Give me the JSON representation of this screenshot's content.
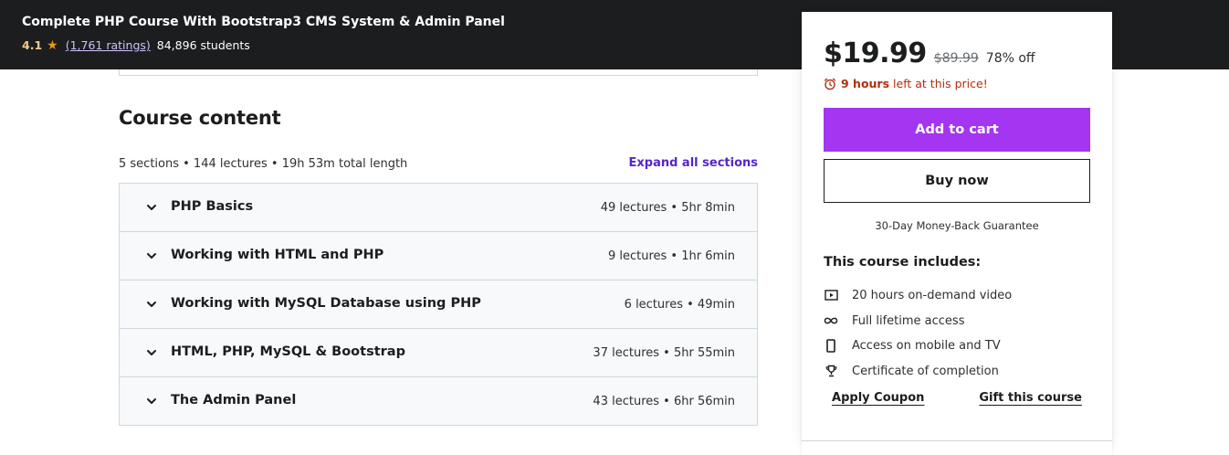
{
  "header": {
    "course_title": "Complete PHP Course With Bootstrap3 CMS System & Admin Panel",
    "rating": "4.1",
    "ratings_link": "(1,761 ratings)",
    "students": "84,896 students"
  },
  "course_content": {
    "title": "Course content",
    "summary": "5 sections • 144 lectures • 19h 53m total length",
    "expand_all": "Expand all sections",
    "sections": [
      {
        "title": "PHP Basics",
        "meta": "49 lectures • 5hr 8min"
      },
      {
        "title": "Working with HTML and PHP",
        "meta": "9 lectures • 1hr 6min"
      },
      {
        "title": "Working with MySQL Database using PHP",
        "meta": "6 lectures • 49min"
      },
      {
        "title": "HTML, PHP, MySQL & Bootstrap",
        "meta": "37 lectures • 5hr 55min"
      },
      {
        "title": "The Admin Panel",
        "meta": "43 lectures • 6hr 56min"
      }
    ]
  },
  "sidebar": {
    "price": "$19.99",
    "original_price": "$89.99",
    "discount": "78% off",
    "timer_hours": "9 hours",
    "timer_text": "left at this price!",
    "add_to_cart": "Add to cart",
    "buy_now": "Buy now",
    "guarantee": "30-Day Money-Back Guarantee",
    "includes_title": "This course includes:",
    "includes": [
      {
        "icon": "video-icon",
        "text": "20 hours on-demand video"
      },
      {
        "icon": "infinity-icon",
        "text": "Full lifetime access"
      },
      {
        "icon": "mobile-icon",
        "text": "Access on mobile and TV"
      },
      {
        "icon": "trophy-icon",
        "text": "Certificate of completion"
      }
    ],
    "apply_coupon": "Apply Coupon",
    "gift_course": "Gift this course"
  },
  "colors": {
    "header_bg": "#1c1d1f",
    "accent_purple": "#a435f0",
    "link_purple": "#5624d0",
    "timer_red": "#b32d0f",
    "star_gold": "#e59819"
  }
}
